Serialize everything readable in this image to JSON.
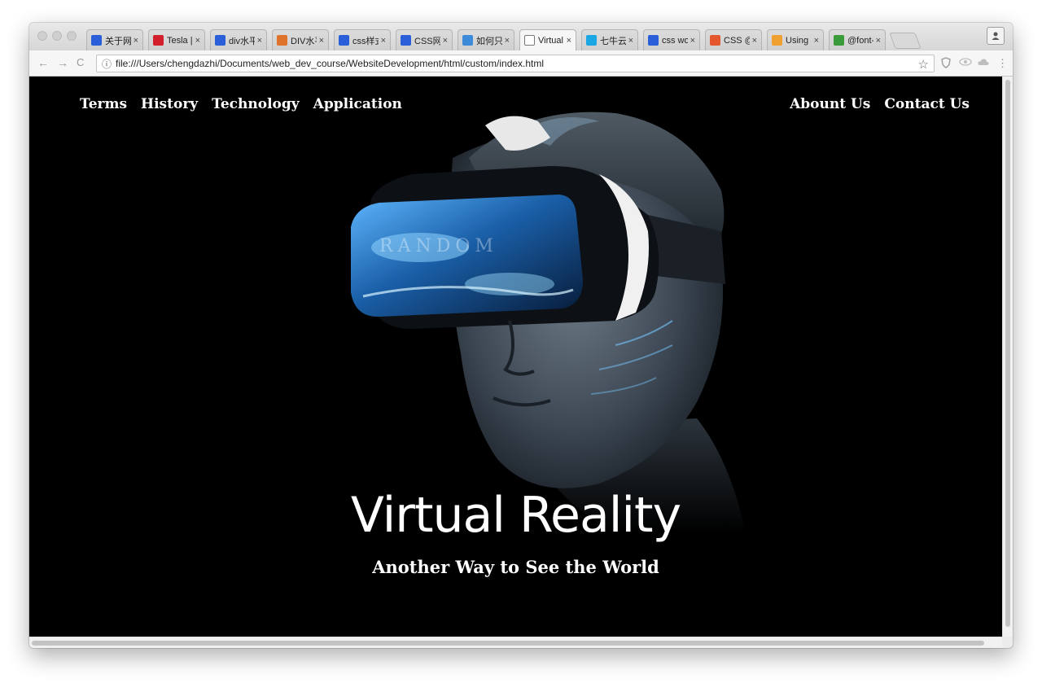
{
  "browser": {
    "tabs": [
      {
        "title": "关于网",
        "favicon_color": "#2b5fd9",
        "active": false
      },
      {
        "title": "Tesla |",
        "favicon_color": "#d21f2b",
        "active": false
      },
      {
        "title": "div水平",
        "favicon_color": "#2b5fd9",
        "active": false
      },
      {
        "title": "DIV水平",
        "favicon_color": "#e0732c",
        "active": false
      },
      {
        "title": "css样式",
        "favicon_color": "#2b5fd9",
        "active": false
      },
      {
        "title": "CSS网",
        "favicon_color": "#2b5fd9",
        "active": false
      },
      {
        "title": "如何只",
        "favicon_color": "#3d8bd8",
        "active": false
      },
      {
        "title": "Virtual",
        "favicon_color": "#ffffff",
        "active": true
      },
      {
        "title": "七牛云",
        "favicon_color": "#1ba7e3",
        "active": false
      },
      {
        "title": "css wo",
        "favicon_color": "#2b5fd9",
        "active": false
      },
      {
        "title": "CSS @",
        "favicon_color": "#e4572e",
        "active": false
      },
      {
        "title": "Using",
        "favicon_color": "#f0a030",
        "active": false
      },
      {
        "title": "@font-",
        "favicon_color": "#3a9b3a",
        "active": false
      }
    ],
    "tab_close": "×",
    "address": "file:///Users/chengdazhi/Documents/web_dev_course/WebsiteDevelopment/html/custom/index.html",
    "info_icon": "ⓘ",
    "back_icon": "←",
    "forward_icon": "→",
    "reload_icon": "C",
    "star_icon": "☆",
    "menu_icon": "⋮"
  },
  "page": {
    "nav_left": [
      "Terms",
      "History",
      "Technology",
      "Application"
    ],
    "nav_right": [
      "Abount Us",
      "Contact Us"
    ],
    "hero_title": "Virtual Reality",
    "hero_subtitle": "Another Way to See the World",
    "watermark": "RANDOM"
  }
}
